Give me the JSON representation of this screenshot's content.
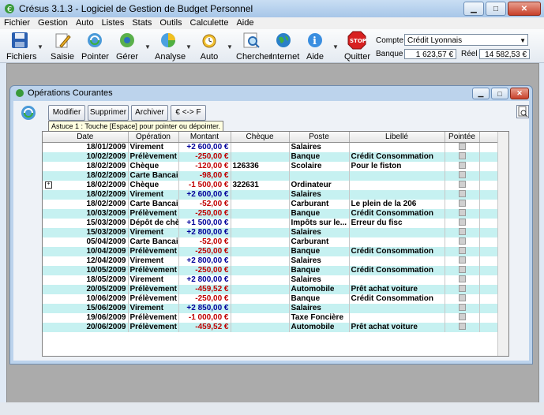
{
  "window": {
    "title": "Crésus 3.1.3 - Logiciel de Gestion de Budget Personnel"
  },
  "menu": [
    "Fichier",
    "Gestion",
    "Auto",
    "Listes",
    "Stats",
    "Outils",
    "Calculette",
    "Aide"
  ],
  "toolbar": {
    "fichiers": "Fichiers",
    "saisie": "Saisie",
    "pointer": "Pointer",
    "gerer": "Gérer",
    "analyse": "Analyse",
    "auto": "Auto",
    "chercher": "Chercher",
    "internet": "Internet",
    "aide": "Aide",
    "quitter": "Quitter"
  },
  "account": {
    "compte_label": "Compte :",
    "compte_value": "Crédit Lyonnais",
    "banque_label": "Banque :",
    "banque_value": "1 623,57 €",
    "reel_label": "Réel :",
    "reel_value": "14 582,53 €"
  },
  "child": {
    "title": "Opérations Courantes",
    "buttons": {
      "modifier": "Modifier",
      "supprimer": "Supprimer",
      "archiver": "Archiver",
      "euro": "€ <-> F"
    },
    "tooltip": "Astuce 1 : Touche [Espace] pour pointer ou dépointer.",
    "columns": [
      "Date",
      "Opération",
      "Montant",
      "Chèque",
      "Poste",
      "Libellé",
      "Pointée"
    ]
  },
  "rows": [
    {
      "date": "18/01/2009",
      "op": "Virement",
      "amount": "+2 600,00 €",
      "sign": "pos",
      "cheque": "",
      "poste": "Salaires",
      "libelle": ""
    },
    {
      "date": "10/02/2009",
      "op": "Prélèvement",
      "amount": "-250,00 €",
      "sign": "neg",
      "cheque": "",
      "poste": "Banque",
      "libelle": "Crédit Consommation"
    },
    {
      "date": "18/02/2009",
      "op": "Chèque",
      "amount": "-120,00 €",
      "sign": "neg",
      "cheque": "126336",
      "poste": "Scolaire",
      "libelle": "Pour le fiston"
    },
    {
      "date": "18/02/2009",
      "op": "Carte Bancaire",
      "amount": "-98,00 €",
      "sign": "neg",
      "cheque": "",
      "poste": "",
      "libelle": ""
    },
    {
      "date": "18/02/2009",
      "op": "Chèque",
      "amount": "-1 500,00 €",
      "sign": "neg",
      "cheque": "322631",
      "poste": "Ordinateur",
      "libelle": ""
    },
    {
      "date": "18/02/2009",
      "op": "Virement",
      "amount": "+2 600,00 €",
      "sign": "pos",
      "cheque": "",
      "poste": "Salaires",
      "libelle": ""
    },
    {
      "date": "18/02/2009",
      "op": "Carte Bancaire",
      "amount": "-52,00 €",
      "sign": "neg",
      "cheque": "",
      "poste": "Carburant",
      "libelle": "Le plein de la 206"
    },
    {
      "date": "10/03/2009",
      "op": "Prélèvement",
      "amount": "-250,00 €",
      "sign": "neg",
      "cheque": "",
      "poste": "Banque",
      "libelle": "Crédit Consommation"
    },
    {
      "date": "15/03/2009",
      "op": "Dépôt de chèque",
      "amount": "+1 500,00 €",
      "sign": "pos",
      "cheque": "",
      "poste": "Impôts sur le...",
      "libelle": "Erreur du fisc"
    },
    {
      "date": "15/03/2009",
      "op": "Virement",
      "amount": "+2 800,00 €",
      "sign": "pos",
      "cheque": "",
      "poste": "Salaires",
      "libelle": ""
    },
    {
      "date": "05/04/2009",
      "op": "Carte Bancaire",
      "amount": "-52,00 €",
      "sign": "neg",
      "cheque": "",
      "poste": "Carburant",
      "libelle": ""
    },
    {
      "date": "10/04/2009",
      "op": "Prélèvement",
      "amount": "-250,00 €",
      "sign": "neg",
      "cheque": "",
      "poste": "Banque",
      "libelle": "Crédit Consommation"
    },
    {
      "date": "12/04/2009",
      "op": "Virement",
      "amount": "+2 800,00 €",
      "sign": "pos",
      "cheque": "",
      "poste": "Salaires",
      "libelle": ""
    },
    {
      "date": "10/05/2009",
      "op": "Prélèvement",
      "amount": "-250,00 €",
      "sign": "neg",
      "cheque": "",
      "poste": "Banque",
      "libelle": "Crédit Consommation"
    },
    {
      "date": "18/05/2009",
      "op": "Virement",
      "amount": "+2 800,00 €",
      "sign": "pos",
      "cheque": "",
      "poste": "Salaires",
      "libelle": ""
    },
    {
      "date": "20/05/2009",
      "op": "Prélèvement",
      "amount": "-459,52 €",
      "sign": "neg",
      "cheque": "",
      "poste": "Automobile",
      "libelle": "Prêt achat voiture"
    },
    {
      "date": "10/06/2009",
      "op": "Prélèvement",
      "amount": "-250,00 €",
      "sign": "neg",
      "cheque": "",
      "poste": "Banque",
      "libelle": "Crédit Consommation"
    },
    {
      "date": "15/06/2009",
      "op": "Virement",
      "amount": "+2 850,00 €",
      "sign": "pos",
      "cheque": "",
      "poste": "Salaires",
      "libelle": ""
    },
    {
      "date": "19/06/2009",
      "op": "Prélèvement",
      "amount": "-1 000,00 €",
      "sign": "neg",
      "cheque": "",
      "poste": "Taxe Foncière",
      "libelle": ""
    },
    {
      "date": "20/06/2009",
      "op": "Prélèvement",
      "amount": "-459,52 €",
      "sign": "neg",
      "cheque": "",
      "poste": "Automobile",
      "libelle": "Prêt achat voiture"
    }
  ],
  "colors": {
    "negative": "#c00000",
    "positive": "#00009a",
    "alt_row": "#c6f1f1"
  }
}
